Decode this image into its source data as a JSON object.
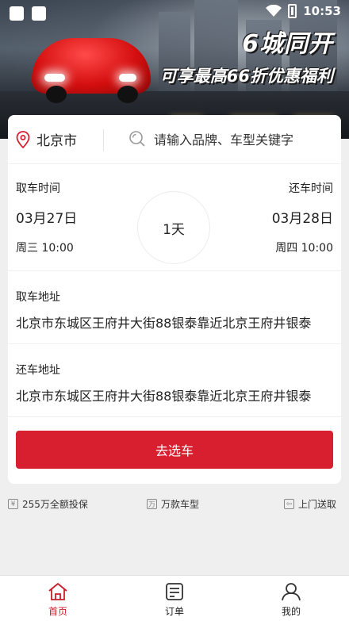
{
  "status_bar": {
    "time": "10:53"
  },
  "banner": {
    "title": "6城同开",
    "subtitle": "可享最高66折优惠福利"
  },
  "search": {
    "city": "北京市",
    "placeholder": "请输入品牌、车型关键字"
  },
  "rental": {
    "pickup_label": "取车时间",
    "return_label": "还车时间",
    "pickup_date": "03月27日",
    "return_date": "03月28日",
    "pickup_time": "周三 10:00",
    "return_time": "周四 10:00",
    "duration": "1天"
  },
  "pickup_address": {
    "label": "取车地址",
    "value": "北京市东城区王府井大街88银泰靠近北京王府井银泰"
  },
  "return_address": {
    "label": "还车地址",
    "value": "北京市东城区王府井大街88银泰靠近北京王府井银泰"
  },
  "action": {
    "select_car": "去选车"
  },
  "features": [
    {
      "icon": "¥",
      "label": "255万全额投保"
    },
    {
      "icon": "万",
      "label": "万款车型"
    },
    {
      "icon": "⇦",
      "label": "上门送取"
    }
  ],
  "tabs": [
    {
      "label": "首页",
      "icon": "home-icon",
      "active": true
    },
    {
      "label": "订单",
      "icon": "order-icon",
      "active": false
    },
    {
      "label": "我的",
      "icon": "profile-icon",
      "active": false
    }
  ],
  "colors": {
    "accent": "#d81f2f",
    "tab_active": "#c81e2c"
  }
}
